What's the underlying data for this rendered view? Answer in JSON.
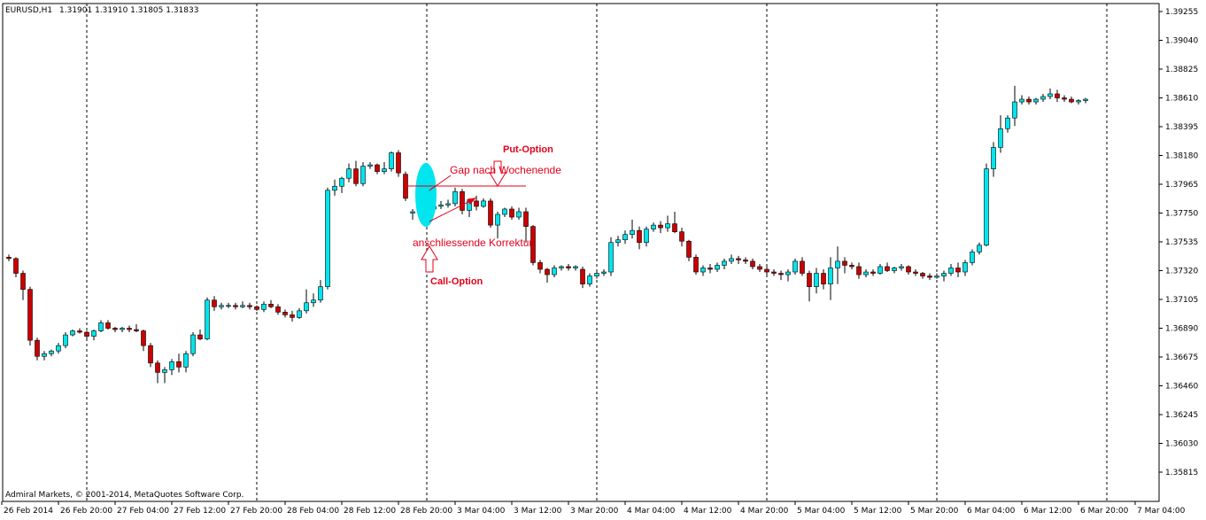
{
  "header": {
    "symbol_timeframe": "EURUSD,H1",
    "ohlc": "1.31901 1.31910 1.31805 1.31833"
  },
  "footer": {
    "copyright": "Admiral Markets, © 2001-2014, MetaQuotes Software Corp."
  },
  "annotations": {
    "put_option": "Put-Option",
    "gap": "Gap nach Wochenende",
    "correction": "anschliessende Korrektur",
    "call_option": "Call-Option"
  },
  "colors": {
    "bull": "#00e5ee",
    "bear": "#cc0000",
    "wick": "#000000",
    "annotation": "#e3001b",
    "highlight": "#00e5ee"
  },
  "chart_data": {
    "type": "candlestick",
    "symbol": "EURUSD",
    "timeframe": "H1",
    "ylim": [
      1.357,
      1.3935
    ],
    "y_ticks": [
      "1.39255",
      "1.39040",
      "1.38825",
      "1.38610",
      "1.38395",
      "1.38180",
      "1.37965",
      "1.37750",
      "1.37535",
      "1.37320",
      "1.37105",
      "1.36890",
      "1.36675",
      "1.36460",
      "1.36245",
      "1.36030",
      "1.35815"
    ],
    "x_ticks": [
      "26 Feb 2014",
      "26 Feb 20:00",
      "27 Feb 04:00",
      "27 Feb 12:00",
      "27 Feb 20:00",
      "28 Feb 04:00",
      "28 Feb 12:00",
      "28 Feb 20:00",
      "3 Mar 04:00",
      "3 Mar 12:00",
      "3 Mar 20:00",
      "4 Mar 04:00",
      "4 Mar 12:00",
      "4 Mar 20:00",
      "5 Mar 04:00",
      "5 Mar 12:00",
      "5 Mar 20:00",
      "6 Mar 04:00",
      "6 Mar 12:00",
      "6 Mar 20:00",
      "7 Mar 04:00"
    ],
    "grid": "vertical dashed at day separators",
    "candles": [
      [
        1.3742,
        1.3744,
        1.3739,
        1.3741
      ],
      [
        1.3741,
        1.3742,
        1.3727,
        1.373
      ],
      [
        1.373,
        1.3732,
        1.371,
        1.3718
      ],
      [
        1.3718,
        1.372,
        1.3676,
        1.368
      ],
      [
        1.368,
        1.3682,
        1.3665,
        1.3668
      ],
      [
        1.3668,
        1.3672,
        1.3665,
        1.367
      ],
      [
        1.367,
        1.3673,
        1.3668,
        1.3672
      ],
      [
        1.3672,
        1.3678,
        1.367,
        1.3676
      ],
      [
        1.3676,
        1.3686,
        1.3674,
        1.3684
      ],
      [
        1.3684,
        1.3688,
        1.3683,
        1.3687
      ],
      [
        1.3687,
        1.3689,
        1.3685,
        1.3686
      ],
      [
        1.3686,
        1.3687,
        1.368,
        1.3683
      ],
      [
        1.3683,
        1.3688,
        1.368,
        1.3687
      ],
      [
        1.3687,
        1.3695,
        1.3686,
        1.3693
      ],
      [
        1.3693,
        1.3695,
        1.3688,
        1.3689
      ],
      [
        1.3689,
        1.369,
        1.3686,
        1.3688
      ],
      [
        1.3688,
        1.369,
        1.3686,
        1.3689
      ],
      [
        1.3689,
        1.3691,
        1.3686,
        1.3688
      ],
      [
        1.3688,
        1.3692,
        1.3686,
        1.3687
      ],
      [
        1.3687,
        1.3688,
        1.3672,
        1.3676
      ],
      [
        1.3676,
        1.3678,
        1.366,
        1.3663
      ],
      [
        1.3663,
        1.3665,
        1.3648,
        1.3656
      ],
      [
        1.3656,
        1.366,
        1.3648,
        1.3658
      ],
      [
        1.3658,
        1.3666,
        1.3654,
        1.3664
      ],
      [
        1.3664,
        1.367,
        1.3656,
        1.366
      ],
      [
        1.366,
        1.3672,
        1.3656,
        1.367
      ],
      [
        1.367,
        1.3686,
        1.3668,
        1.3684
      ],
      [
        1.3684,
        1.3688,
        1.368,
        1.3681
      ],
      [
        1.3681,
        1.3712,
        1.368,
        1.371
      ],
      [
        1.371,
        1.3713,
        1.3702,
        1.3705
      ],
      [
        1.3705,
        1.3708,
        1.3703,
        1.3706
      ],
      [
        1.3706,
        1.3708,
        1.3704,
        1.3706
      ],
      [
        1.3706,
        1.3708,
        1.3703,
        1.3705
      ],
      [
        1.3705,
        1.3709,
        1.3704,
        1.3706
      ],
      [
        1.3706,
        1.3708,
        1.3703,
        1.3705
      ],
      [
        1.3705,
        1.3706,
        1.3702,
        1.3703
      ],
      [
        1.3703,
        1.3709,
        1.3701,
        1.3707
      ],
      [
        1.3707,
        1.371,
        1.3704,
        1.3705
      ],
      [
        1.3705,
        1.3707,
        1.3699,
        1.3701
      ],
      [
        1.3701,
        1.3703,
        1.3697,
        1.3699
      ],
      [
        1.3699,
        1.3702,
        1.3694,
        1.3697
      ],
      [
        1.3697,
        1.3704,
        1.3696,
        1.3702
      ],
      [
        1.3702,
        1.3718,
        1.37,
        1.3708
      ],
      [
        1.3708,
        1.3715,
        1.3705,
        1.371
      ],
      [
        1.371,
        1.3725,
        1.3708,
        1.372
      ],
      [
        1.372,
        1.3794,
        1.3718,
        1.3792
      ],
      [
        1.3792,
        1.38,
        1.3788,
        1.3795
      ],
      [
        1.3795,
        1.3802,
        1.379,
        1.3801
      ],
      [
        1.3801,
        1.3812,
        1.3798,
        1.3808
      ],
      [
        1.3808,
        1.3814,
        1.3795,
        1.3797
      ],
      [
        1.3797,
        1.3813,
        1.3795,
        1.381
      ],
      [
        1.381,
        1.3813,
        1.3808,
        1.3811
      ],
      [
        1.3811,
        1.3812,
        1.3804,
        1.3806
      ],
      [
        1.3806,
        1.3813,
        1.3804,
        1.3808
      ],
      [
        1.3808,
        1.3821,
        1.3806,
        1.382
      ],
      [
        1.382,
        1.3822,
        1.3802,
        1.3805
      ],
      [
        1.3804,
        1.3806,
        1.3784,
        1.3786
      ],
      [
        1.3775,
        1.3778,
        1.377,
        1.3776
      ],
      [
        1.3776,
        1.3779,
        1.3774,
        1.3777
      ],
      [
        1.3777,
        1.378,
        1.3775,
        1.3778
      ],
      [
        1.3778,
        1.3781,
        1.3776,
        1.378
      ],
      [
        1.378,
        1.3784,
        1.3778,
        1.3781
      ],
      [
        1.3781,
        1.3785,
        1.3779,
        1.3782
      ],
      [
        1.3782,
        1.3794,
        1.378,
        1.3791
      ],
      [
        1.3791,
        1.3793,
        1.3774,
        1.3777
      ],
      [
        1.3777,
        1.3786,
        1.3772,
        1.3784
      ],
      [
        1.3784,
        1.3788,
        1.3777,
        1.378
      ],
      [
        1.378,
        1.3786,
        1.3779,
        1.3784
      ],
      [
        1.3784,
        1.3786,
        1.3764,
        1.3766
      ],
      [
        1.3766,
        1.3776,
        1.3756,
        1.3774
      ],
      [
        1.3774,
        1.3779,
        1.3772,
        1.3778
      ],
      [
        1.3778,
        1.378,
        1.377,
        1.3772
      ],
      [
        1.3772,
        1.3779,
        1.377,
        1.3776
      ],
      [
        1.3776,
        1.3779,
        1.3753,
        1.3765
      ],
      [
        1.3765,
        1.3766,
        1.3736,
        1.3738
      ],
      [
        1.3738,
        1.374,
        1.373,
        1.3733
      ],
      [
        1.3733,
        1.3734,
        1.3723,
        1.3729
      ],
      [
        1.3729,
        1.3736,
        1.3727,
        1.3734
      ],
      [
        1.3734,
        1.3736,
        1.3732,
        1.3735
      ],
      [
        1.3735,
        1.3737,
        1.3732,
        1.3734
      ],
      [
        1.3734,
        1.3736,
        1.3732,
        1.3735
      ],
      [
        1.3733,
        1.3735,
        1.3719,
        1.3722
      ],
      [
        1.3722,
        1.373,
        1.372,
        1.3728
      ],
      [
        1.3728,
        1.3732,
        1.3726,
        1.373
      ],
      [
        1.373,
        1.3733,
        1.3728,
        1.3731
      ],
      [
        1.3731,
        1.3757,
        1.3728,
        1.3753
      ],
      [
        1.3753,
        1.3758,
        1.375,
        1.3755
      ],
      [
        1.3755,
        1.3762,
        1.3752,
        1.3759
      ],
      [
        1.3759,
        1.377,
        1.3756,
        1.3762
      ],
      [
        1.3762,
        1.3765,
        1.3748,
        1.3753
      ],
      [
        1.3753,
        1.3765,
        1.375,
        1.3763
      ],
      [
        1.3763,
        1.3768,
        1.3761,
        1.3766
      ],
      [
        1.3766,
        1.3769,
        1.376,
        1.3764
      ],
      [
        1.3764,
        1.3773,
        1.3761,
        1.3767
      ],
      [
        1.3767,
        1.3776,
        1.376,
        1.3761
      ],
      [
        1.3761,
        1.3764,
        1.375,
        1.3754
      ],
      [
        1.3754,
        1.3755,
        1.3739,
        1.3742
      ],
      [
        1.3742,
        1.3744,
        1.3729,
        1.3731
      ],
      [
        1.3731,
        1.3736,
        1.3728,
        1.3734
      ],
      [
        1.3734,
        1.3737,
        1.373,
        1.3733
      ],
      [
        1.3733,
        1.3738,
        1.3731,
        1.3736
      ],
      [
        1.3736,
        1.3741,
        1.3733,
        1.3739
      ],
      [
        1.3739,
        1.3744,
        1.3737,
        1.3741
      ],
      [
        1.3741,
        1.3743,
        1.3737,
        1.374
      ],
      [
        1.374,
        1.3742,
        1.3737,
        1.3739
      ],
      [
        1.3739,
        1.3741,
        1.3733,
        1.3735
      ],
      [
        1.3735,
        1.3737,
        1.3731,
        1.3733
      ],
      [
        1.3733,
        1.3735,
        1.3729,
        1.3731
      ],
      [
        1.3731,
        1.3733,
        1.3728,
        1.373
      ],
      [
        1.373,
        1.3732,
        1.3725,
        1.3729
      ],
      [
        1.3729,
        1.3733,
        1.3724,
        1.3731
      ],
      [
        1.3731,
        1.3741,
        1.3729,
        1.3739
      ],
      [
        1.3739,
        1.3742,
        1.3728,
        1.373
      ],
      [
        1.373,
        1.3732,
        1.3709,
        1.372
      ],
      [
        1.372,
        1.3734,
        1.3715,
        1.373
      ],
      [
        1.373,
        1.3733,
        1.3718,
        1.3722
      ],
      [
        1.3722,
        1.3742,
        1.371,
        1.3734
      ],
      [
        1.3734,
        1.375,
        1.3722,
        1.3739
      ],
      [
        1.3739,
        1.3742,
        1.373,
        1.3736
      ],
      [
        1.3736,
        1.3738,
        1.3733,
        1.3735
      ],
      [
        1.3735,
        1.3738,
        1.3726,
        1.3729
      ],
      [
        1.3729,
        1.3733,
        1.3727,
        1.3731
      ],
      [
        1.3731,
        1.3733,
        1.3728,
        1.373
      ],
      [
        1.373,
        1.3737,
        1.3729,
        1.3735
      ],
      [
        1.3735,
        1.3738,
        1.3731,
        1.3732
      ],
      [
        1.3732,
        1.3735,
        1.373,
        1.3734
      ],
      [
        1.3734,
        1.3737,
        1.3732,
        1.3735
      ],
      [
        1.3735,
        1.3736,
        1.3729,
        1.3731
      ],
      [
        1.3731,
        1.3733,
        1.3728,
        1.373
      ],
      [
        1.373,
        1.3731,
        1.3726,
        1.3728
      ],
      [
        1.3728,
        1.373,
        1.3725,
        1.3727
      ],
      [
        1.3727,
        1.373,
        1.3726,
        1.3728
      ],
      [
        1.3728,
        1.3732,
        1.3724,
        1.373
      ],
      [
        1.373,
        1.3737,
        1.3728,
        1.3734
      ],
      [
        1.3734,
        1.3738,
        1.3727,
        1.3731
      ],
      [
        1.3731,
        1.374,
        1.3728,
        1.3738
      ],
      [
        1.3738,
        1.3748,
        1.3736,
        1.3746
      ],
      [
        1.3746,
        1.3753,
        1.3744,
        1.3751
      ],
      [
        1.3751,
        1.3812,
        1.375,
        1.3808
      ],
      [
        1.3808,
        1.3828,
        1.3802,
        1.3824
      ],
      [
        1.3824,
        1.3848,
        1.382,
        1.3838
      ],
      [
        1.3838,
        1.3848,
        1.3835,
        1.3846
      ],
      [
        1.3846,
        1.387,
        1.384,
        1.3858
      ],
      [
        1.3858,
        1.3863,
        1.3856,
        1.386
      ],
      [
        1.386,
        1.3862,
        1.3856,
        1.3858
      ],
      [
        1.3858,
        1.3861,
        1.3856,
        1.386
      ],
      [
        1.386,
        1.3864,
        1.3858,
        1.3862
      ],
      [
        1.3862,
        1.3868,
        1.386,
        1.3864
      ],
      [
        1.3864,
        1.3867,
        1.3858,
        1.3861
      ],
      [
        1.3861,
        1.3863,
        1.3858,
        1.386
      ],
      [
        1.386,
        1.3862,
        1.3857,
        1.3858
      ],
      [
        1.3858,
        1.386,
        1.3856,
        1.3859
      ],
      [
        1.3859,
        1.3861,
        1.3857,
        1.386
      ]
    ]
  }
}
